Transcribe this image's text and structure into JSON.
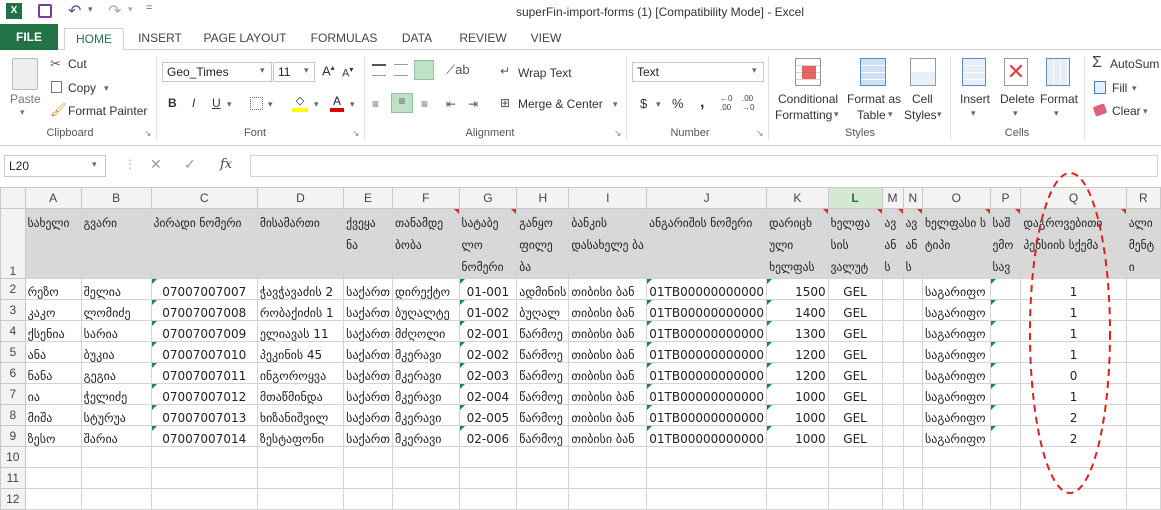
{
  "window": {
    "title": "superFin-import-forms (1)  [Compatibility Mode] - Excel"
  },
  "tabs": [
    "FILE",
    "HOME",
    "INSERT",
    "PAGE LAYOUT",
    "FORMULAS",
    "DATA",
    "REVIEW",
    "VIEW"
  ],
  "ribbon": {
    "clipboard": {
      "paste": "Paste",
      "cut": "Cut",
      "copy": "Copy",
      "format_painter": "Format Painter",
      "label": "Clipboard"
    },
    "font": {
      "name": "Geo_Times",
      "size": "11",
      "bold": "B",
      "italic": "I",
      "underline": "U",
      "label": "Font"
    },
    "alignment": {
      "wrap": "Wrap Text",
      "merge": "Merge & Center",
      "label": "Alignment"
    },
    "number": {
      "format": "Text",
      "currency": "$",
      "percent": "%",
      "comma": ",",
      "label": "Number"
    },
    "styles": {
      "cond1": "Conditional",
      "cond2": "Formatting",
      "fmt1": "Format as",
      "fmt2": "Table",
      "cell1": "Cell",
      "cell2": "Styles",
      "label": "Styles"
    },
    "cells": {
      "insert": "Insert",
      "delete": "Delete",
      "format": "Format",
      "label": "Cells"
    },
    "editing": {
      "autosum": "AutoSum",
      "fill": "Fill",
      "clear": "Clear"
    }
  },
  "formula_bar": {
    "name_box": "L20",
    "fx": "fx",
    "value": ""
  },
  "sheet": {
    "columns": [
      "A",
      "B",
      "C",
      "D",
      "E",
      "F",
      "G",
      "H",
      "I",
      "J",
      "K",
      "L",
      "M",
      "N",
      "O",
      "P",
      "Q",
      "R"
    ],
    "row_numbers": [
      "1",
      "2",
      "3",
      "4",
      "5",
      "6",
      "7",
      "8",
      "9",
      "10",
      "11",
      "12"
    ],
    "headers": [
      "სახელი",
      "გვარი",
      "პირადი ნომერი",
      "მისამართი",
      "ქვეყა ნა",
      "თანამდე ბობა",
      "სატაბე ლო ნომერი",
      "განყო ფილე ბა",
      "ბანკის დასახელე ბა",
      "ანგარიშის ნომერი",
      "დარიცხ ული ხელფას",
      "ხელფა სის ვალუტ",
      "ავ ან ს",
      "ავ ან ს",
      "ხელფასი ს ტიპი",
      "საშ ემო სავ",
      "დაგროვებითი პენსიის სქემა",
      "ალი მენტ ი"
    ],
    "rows": [
      [
        "რეზო",
        "შელია",
        "07007007007",
        "ჭავჭავაძის 2",
        "საქართ",
        "დირექტო",
        "01-001",
        "ადმინის",
        "თიბისი ბან",
        "01TB00000000000",
        "1500",
        "GEL",
        "",
        "",
        "საგარიფო",
        "",
        "1",
        ""
      ],
      [
        "კაკო",
        "ლომიძე",
        "07007007008",
        "რობაქიძის 1",
        "საქართ",
        "ბუღალტე",
        "01-002",
        "ბუღალ",
        "თიბისი ბან",
        "01TB00000000000",
        "1400",
        "GEL",
        "",
        "",
        "საგარიფო",
        "",
        "1",
        ""
      ],
      [
        "ქსენია",
        "სარია",
        "07007007009",
        "ელიავას 11",
        "საქართ",
        "მძღოლი",
        "02-001",
        "წარმოე",
        "თიბისი ბან",
        "01TB00000000000",
        "1300",
        "GEL",
        "",
        "",
        "საგარიფო",
        "",
        "1",
        ""
      ],
      [
        "ანა",
        "ბუკია",
        "07007007010",
        "პეკინის 45",
        "საქართ",
        "მკერავი",
        "02-002",
        "წარმოე",
        "თიბისი ბან",
        "01TB00000000000",
        "1200",
        "GEL",
        "",
        "",
        "საგარიფო",
        "",
        "1",
        ""
      ],
      [
        "ნანა",
        "გეგია",
        "07007007011",
        "ინგოროყვა",
        "საქართ",
        "მკერავი",
        "02-003",
        "წარმოე",
        "თიბისი ბან",
        "01TB00000000000",
        "1200",
        "GEL",
        "",
        "",
        "საგარიფო",
        "",
        "0",
        ""
      ],
      [
        "ია",
        "ჭელიძე",
        "07007007012",
        "მთაწმინდა",
        "საქართ",
        "მკერავი",
        "02-004",
        "წარმოე",
        "თიბისი ბან",
        "01TB00000000000",
        "1000",
        "GEL",
        "",
        "",
        "საგარიფო",
        "",
        "1",
        ""
      ],
      [
        "მიშა",
        "სტურუა",
        "07007007013",
        "ხიზანიშვილ",
        "საქართ",
        "მკერავი",
        "02-005",
        "წარმოე",
        "თიბისი ბან",
        "01TB00000000000",
        "1000",
        "GEL",
        "",
        "",
        "საგარიფო",
        "",
        "2",
        ""
      ],
      [
        "ზესო",
        "შარია",
        "07007007014",
        "ზესტაფონი",
        "საქართ",
        "მკერავი",
        "02-006",
        "წარმოე",
        "თიბისი ბან",
        "01TB00000000000",
        "1000",
        "GEL",
        "",
        "",
        "საგარიფო",
        "",
        "2",
        ""
      ]
    ]
  },
  "colors": {
    "excel_green": "#217346",
    "annotation_red": "#e02020"
  }
}
